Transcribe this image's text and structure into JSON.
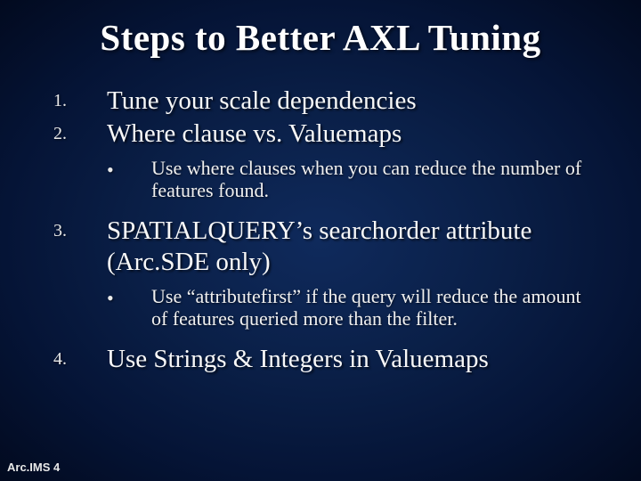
{
  "title": "Steps to Better AXL Tuning",
  "items": {
    "n1": {
      "marker": "1.",
      "text": "Tune your scale dependencies"
    },
    "n2": {
      "marker": "2.",
      "text": "Where clause vs. Valuemaps"
    },
    "s1": {
      "marker": "•",
      "text": "Use where clauses when you can reduce the number of features found."
    },
    "n3": {
      "marker": "3.",
      "text": "SPATIALQUERY’s searchorder attribute (Arc.SDE only)"
    },
    "s2": {
      "marker": "•",
      "text": "Use “attributefirst” if the query will reduce the amount of features queried more than the filter."
    },
    "n4": {
      "marker": "4.",
      "text": "Use Strings & Integers in Valuemaps"
    }
  },
  "footer": "Arc.IMS 4"
}
